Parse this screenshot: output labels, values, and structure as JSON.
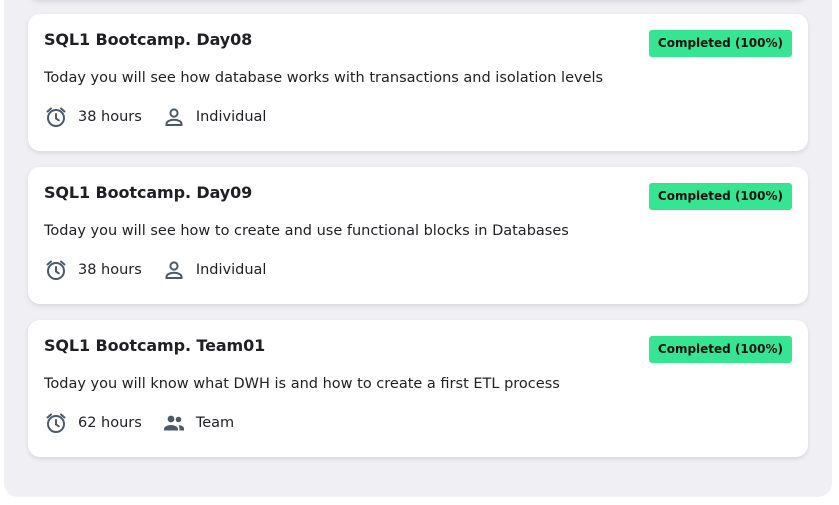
{
  "cards": [
    {
      "title": "SQL1 Bootcamp. Day08",
      "status": "Completed (100%)",
      "description": "Today you will see how database works with transactions and isolation levels",
      "duration": "38 hours",
      "format": "Individual",
      "format_icon": "person-icon"
    },
    {
      "title": "SQL1 Bootcamp. Day09",
      "status": "Completed (100%)",
      "description": "Today you will see how to create and use functional blocks in Databases",
      "duration": "38 hours",
      "format": "Individual",
      "format_icon": "person-icon"
    },
    {
      "title": "SQL1 Bootcamp. Team01",
      "status": "Completed (100%)",
      "description": "Today you will know what DWH is and how to create a first ETL process",
      "duration": "62 hours",
      "format": "Team",
      "format_icon": "people-icon"
    }
  ],
  "colors": {
    "badge": "#35e591",
    "panel": "#efeff4",
    "icon": "#4a5a6a"
  }
}
